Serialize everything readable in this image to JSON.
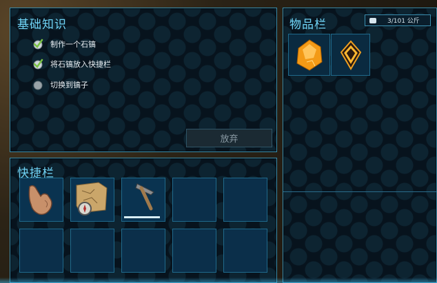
{
  "basics": {
    "title": "基础知识",
    "tasks": [
      {
        "label": "制作一个石镐",
        "done": true
      },
      {
        "label": "将石镐放入快捷栏",
        "done": true
      },
      {
        "label": "切换到镐子",
        "done": false
      }
    ],
    "give_up_label": "放弃"
  },
  "hotbar": {
    "title": "快捷栏",
    "slots": [
      {
        "item": "hand-icon"
      },
      {
        "item": "map-compass-icon"
      },
      {
        "item": "stone-pickaxe-icon",
        "durability": 1.0
      },
      {
        "item": ""
      },
      {
        "item": ""
      },
      {
        "item": ""
      },
      {
        "item": ""
      },
      {
        "item": ""
      },
      {
        "item": ""
      },
      {
        "item": ""
      }
    ]
  },
  "inventory": {
    "title": "物品栏",
    "weight": "3/101 公斤",
    "items": [
      {
        "item": "amber-resource-icon"
      },
      {
        "item": "implant-icon"
      }
    ]
  },
  "colors": {
    "accent": "#6fd3f5",
    "panel_border": "#3a8fb0",
    "slot_bg": "#0a3350",
    "check_green": "#7ac143"
  }
}
